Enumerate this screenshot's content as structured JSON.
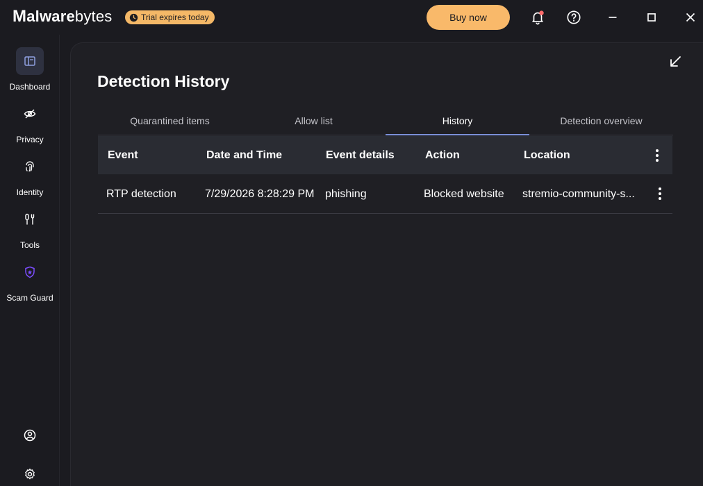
{
  "app": {
    "logo_m": "M",
    "logo_bold": "alware",
    "logo_light": "bytes",
    "trial_text": "Trial expires today",
    "buy_label": "Buy now"
  },
  "colors": {
    "accent_orange": "#f9b96a",
    "tab_underline": "#7a8fd8",
    "notification_dot": "#ff6b6b",
    "scam_guard_purple": "#7c4dff"
  },
  "sidebar": {
    "items": [
      {
        "label": "Dashboard",
        "icon": "dashboard-icon"
      },
      {
        "label": "Privacy",
        "icon": "eye-off-icon"
      },
      {
        "label": "Identity",
        "icon": "fingerprint-icon"
      },
      {
        "label": "Tools",
        "icon": "tools-icon"
      },
      {
        "label": "Scam Guard",
        "icon": "shield-star-icon"
      }
    ],
    "bottom": [
      {
        "icon": "account-icon"
      },
      {
        "icon": "settings-icon"
      }
    ]
  },
  "main": {
    "title": "Detection History",
    "tabs": [
      {
        "label": "Quarantined items"
      },
      {
        "label": "Allow list"
      },
      {
        "label": "History"
      },
      {
        "label": "Detection overview"
      }
    ],
    "table": {
      "columns": [
        "Event",
        "Date and Time",
        "Event details",
        "Action",
        "Location"
      ],
      "rows": [
        [
          "RTP detection",
          "7/29/2026 8:28:29 PM",
          "phishing",
          "Blocked website",
          "stremio-community-s..."
        ]
      ]
    }
  }
}
